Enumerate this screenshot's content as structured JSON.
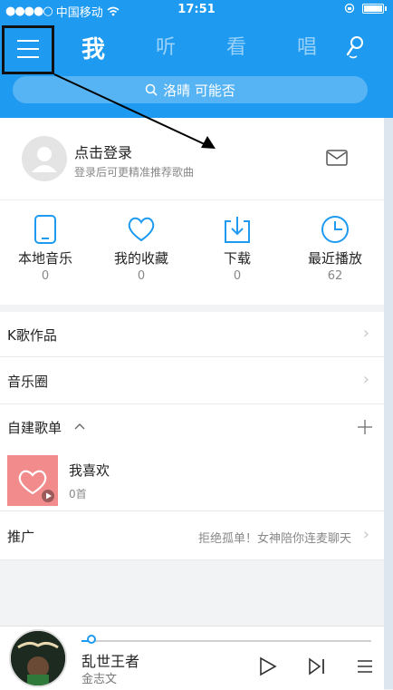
{
  "status_bar": {
    "signal": "●●●●○",
    "carrier": "中国移动",
    "time": "17:51"
  },
  "nav": {
    "tabs": [
      "我",
      "听",
      "看",
      "唱"
    ],
    "active_tab": "我"
  },
  "search": {
    "placeholder": "洛晴 可能否"
  },
  "profile": {
    "title": "点击登录",
    "subtitle": "登录后可更精准推荐歌曲"
  },
  "stats": [
    {
      "label": "本地音乐",
      "count": "0",
      "icon": "phone-icon"
    },
    {
      "label": "我的收藏",
      "count": "0",
      "icon": "heart-icon"
    },
    {
      "label": "下载",
      "count": "0",
      "icon": "download-icon"
    },
    {
      "label": "最近播放",
      "count": "62",
      "icon": "clock-icon"
    }
  ],
  "list": {
    "k_song": "K歌作品",
    "music_circle": "音乐圈",
    "playlists_header": "自建歌单",
    "playlist_item": {
      "title": "我喜欢",
      "count": "0首"
    },
    "promo_label": "推广",
    "promo_text": "拒绝孤单！女神陪你连麦聊天"
  },
  "player": {
    "song": "乱世王者",
    "artist": "金志文",
    "progress": 0.03
  },
  "colors": {
    "accent": "#1e9af0",
    "playlist_cover": "#f28b8b"
  }
}
